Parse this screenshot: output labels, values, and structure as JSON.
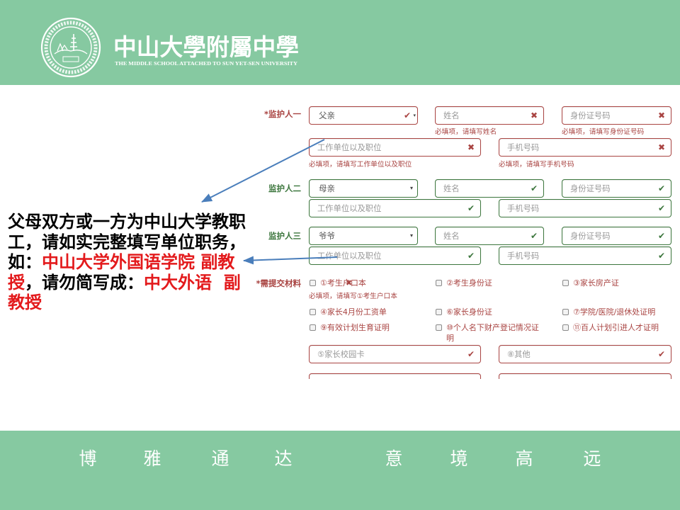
{
  "header": {
    "logo_icon": "school-seal-icon",
    "school_name": "中山大學附屬中學",
    "school_name_en": "THE MIDDLE SCHOOL ATTACHED TO SUN YET-SEN UNIVERSITY"
  },
  "colors": {
    "brand_green": "#86c9a1",
    "error": "#a94442",
    "success": "#3c763d",
    "arrow": "#4a7ebb",
    "annotation_emphasis": "#e31a1c"
  },
  "guardians": [
    {
      "label": "*监护人一",
      "relation": {
        "value": "父亲",
        "icon": "check-icon"
      },
      "name": {
        "placeholder": "姓名",
        "icon": "cross-icon",
        "help": "必填项，请填写姓名"
      },
      "id_number": {
        "placeholder": "身份证号码",
        "icon": "cross-icon",
        "help": "必填项，请填写身份证号码"
      },
      "employer": {
        "placeholder": "工作单位以及职位",
        "icon": "cross-icon",
        "help": "必填项，请填写工作单位以及职位"
      },
      "phone": {
        "placeholder": "手机号码",
        "icon": "cross-icon",
        "help": "必填项，请填写手机号码"
      }
    },
    {
      "label": "监护人二",
      "relation": {
        "value": "母亲",
        "icon": "chevron-down-icon"
      },
      "name": {
        "placeholder": "姓名",
        "icon": "check-icon"
      },
      "id_number": {
        "placeholder": "身份证号码",
        "icon": "check-icon"
      },
      "employer": {
        "placeholder": "工作单位以及职位",
        "icon": "check-icon"
      },
      "phone": {
        "placeholder": "手机号码",
        "icon": "check-icon"
      }
    },
    {
      "label": "监护人三",
      "relation": {
        "value": "爷爷",
        "icon": "chevron-down-icon"
      },
      "name": {
        "placeholder": "姓名",
        "icon": "check-icon"
      },
      "id_number": {
        "placeholder": "身份证号码",
        "icon": "check-icon"
      },
      "employer": {
        "placeholder": "工作单位以及职位",
        "icon": "check-icon"
      },
      "phone": {
        "placeholder": "手机号码",
        "icon": "check-icon"
      }
    }
  ],
  "materials": {
    "label": "*需提交材料",
    "help": "必填项，请填写①考生户口本",
    "checkboxes": [
      {
        "label": "①考生户口本",
        "checked": false
      },
      {
        "label": "②考生身份证",
        "checked": false
      },
      {
        "label": "③家长房产证",
        "checked": false
      },
      {
        "label": "④家长4月份工资单",
        "checked": false
      },
      {
        "label": "⑥家长身份证",
        "checked": false
      },
      {
        "label": "⑦学院/医院/退休处证明",
        "checked": false
      },
      {
        "label": "⑨有效计划生育证明",
        "checked": false
      },
      {
        "label": "⑩个人名下财产登记情况证明",
        "checked": false
      },
      {
        "label": "⑪百人计划引进人才证明",
        "checked": false
      }
    ],
    "inputs": [
      {
        "placeholder": "⑤家长校园卡",
        "icon": "check-icon"
      },
      {
        "placeholder": "⑧其他",
        "icon": "check-icon"
      }
    ]
  },
  "annotation": {
    "lines": [
      [
        {
          "text": "父母双方或一方为中山大学教职",
          "emphasis": false
        }
      ],
      [
        {
          "text": "工，请如实完整填写单位职务，",
          "emphasis": false
        }
      ],
      [
        {
          "text": "如：",
          "emphasis": false
        },
        {
          "text": "中山大学外国语学院 副教",
          "emphasis": true
        }
      ],
      [
        {
          "text": "授",
          "emphasis": true
        },
        {
          "text": "，请勿简写成：",
          "emphasis": false
        },
        {
          "text": "中大外语  副",
          "emphasis": true
        }
      ],
      [
        {
          "text": "教授",
          "emphasis": true
        }
      ]
    ]
  },
  "motto": [
    "博",
    "雅",
    "通",
    "达",
    "意",
    "境",
    "高",
    "远"
  ]
}
